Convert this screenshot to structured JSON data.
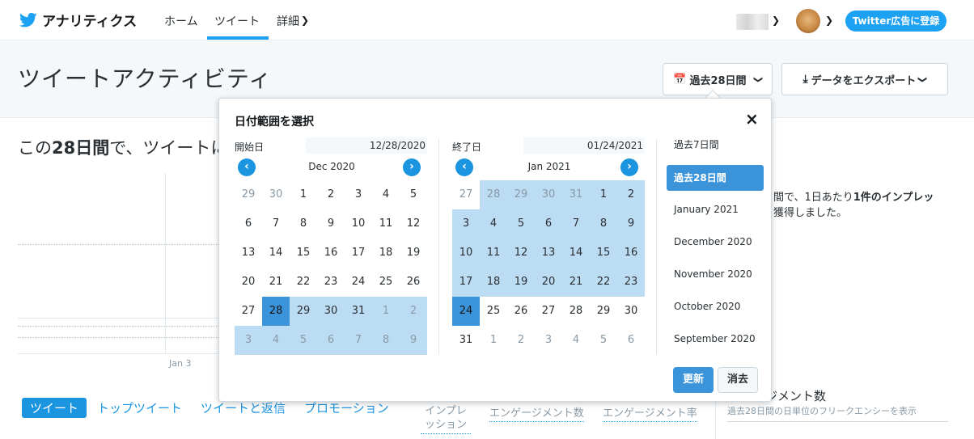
{
  "nav": {
    "brand": "アナリティクス",
    "links": [
      "ホーム",
      "ツイート",
      "詳細"
    ],
    "ads_button": "Twitter広告に登録"
  },
  "header": {
    "title": "ツイートアクティビティ",
    "range_button": "過去28日間",
    "export_button": "データをエクスポート"
  },
  "summary": {
    "prefix": "この",
    "bold": "28日間",
    "suffix": "で、ツイートに"
  },
  "chart": {
    "x_label": "Jan 3"
  },
  "side_text": {
    "line1_a": "間で、1日あたり",
    "line1_b": "1件のインプレッ",
    "line2": "獲得しました。"
  },
  "tabs": [
    "ツイート",
    "トップツイート",
    "ツイートと返信",
    "プロモーション"
  ],
  "metrics": [
    "インプレッション",
    "エンゲージメント数",
    "エンゲージメント率"
  ],
  "engagement_panel": {
    "title": "ジメント数",
    "subtitle": "過去28日間の日単位のフリークエンシーを表示"
  },
  "date_picker": {
    "title": "日付範囲を選択",
    "close": "×",
    "start": {
      "label": "開始日",
      "value": "12/28/2020",
      "month": "Dec 2020",
      "days": [
        {
          "d": "29",
          "m": 1
        },
        {
          "d": "30",
          "m": 1
        },
        {
          "d": "1"
        },
        {
          "d": "2"
        },
        {
          "d": "3"
        },
        {
          "d": "4"
        },
        {
          "d": "5"
        },
        {
          "d": "6"
        },
        {
          "d": "7"
        },
        {
          "d": "8"
        },
        {
          "d": "9"
        },
        {
          "d": "10"
        },
        {
          "d": "11"
        },
        {
          "d": "12"
        },
        {
          "d": "13"
        },
        {
          "d": "14"
        },
        {
          "d": "15"
        },
        {
          "d": "16"
        },
        {
          "d": "17"
        },
        {
          "d": "18"
        },
        {
          "d": "19"
        },
        {
          "d": "20"
        },
        {
          "d": "21"
        },
        {
          "d": "22"
        },
        {
          "d": "23"
        },
        {
          "d": "24"
        },
        {
          "d": "25"
        },
        {
          "d": "26"
        },
        {
          "d": "27"
        },
        {
          "d": "28",
          "s": 1
        },
        {
          "d": "29",
          "r": 1
        },
        {
          "d": "30",
          "r": 1
        },
        {
          "d": "31",
          "r": 1
        },
        {
          "d": "1",
          "m": 1,
          "r": 1
        },
        {
          "d": "2",
          "m": 1,
          "r": 1
        },
        {
          "d": "3",
          "m": 1,
          "r": 1
        },
        {
          "d": "4",
          "m": 1,
          "r": 1
        },
        {
          "d": "5",
          "m": 1,
          "r": 1
        },
        {
          "d": "6",
          "m": 1,
          "r": 1
        },
        {
          "d": "7",
          "m": 1,
          "r": 1
        },
        {
          "d": "8",
          "m": 1,
          "r": 1
        },
        {
          "d": "9",
          "m": 1,
          "r": 1
        }
      ]
    },
    "end": {
      "label": "終了日",
      "value": "01/24/2021",
      "month": "Jan 2021",
      "days": [
        {
          "d": "27",
          "m": 1
        },
        {
          "d": "28",
          "m": 1,
          "r": 1
        },
        {
          "d": "29",
          "m": 1,
          "r": 1
        },
        {
          "d": "30",
          "m": 1,
          "r": 1
        },
        {
          "d": "31",
          "m": 1,
          "r": 1
        },
        {
          "d": "1",
          "r": 1
        },
        {
          "d": "2",
          "r": 1
        },
        {
          "d": "3",
          "r": 1
        },
        {
          "d": "4",
          "r": 1
        },
        {
          "d": "5",
          "r": 1
        },
        {
          "d": "6",
          "r": 1
        },
        {
          "d": "7",
          "r": 1
        },
        {
          "d": "8",
          "r": 1
        },
        {
          "d": "9",
          "r": 1
        },
        {
          "d": "10",
          "r": 1
        },
        {
          "d": "11",
          "r": 1
        },
        {
          "d": "12",
          "r": 1
        },
        {
          "d": "13",
          "r": 1
        },
        {
          "d": "14",
          "r": 1
        },
        {
          "d": "15",
          "r": 1
        },
        {
          "d": "16",
          "r": 1
        },
        {
          "d": "17",
          "r": 1
        },
        {
          "d": "18",
          "r": 1
        },
        {
          "d": "19",
          "r": 1
        },
        {
          "d": "20",
          "r": 1
        },
        {
          "d": "21",
          "r": 1
        },
        {
          "d": "22",
          "r": 1
        },
        {
          "d": "23",
          "r": 1
        },
        {
          "d": "24",
          "s": 1
        },
        {
          "d": "25"
        },
        {
          "d": "26"
        },
        {
          "d": "27"
        },
        {
          "d": "28"
        },
        {
          "d": "29"
        },
        {
          "d": "30"
        },
        {
          "d": "31"
        },
        {
          "d": "1",
          "m": 1
        },
        {
          "d": "2",
          "m": 1
        },
        {
          "d": "3",
          "m": 1
        },
        {
          "d": "4",
          "m": 1
        },
        {
          "d": "5",
          "m": 1
        },
        {
          "d": "6",
          "m": 1
        }
      ]
    },
    "presets": [
      "過去7日間",
      "過去28日間",
      "January 2021",
      "December 2020",
      "November 2020",
      "October 2020",
      "September 2020"
    ],
    "active_preset": "過去28日間",
    "update_button": "更新",
    "clear_button": "消去"
  },
  "colors": {
    "accent": "#1da1f2",
    "selected_day": "#3b94d9",
    "range_day": "#bcdcf4"
  }
}
